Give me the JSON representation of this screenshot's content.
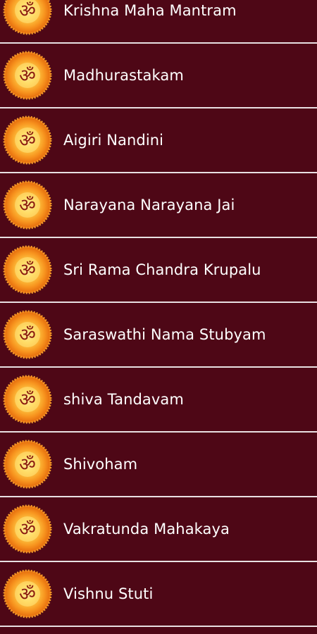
{
  "list": {
    "items": [
      {
        "label": "Krishna Maha Mantram",
        "icon": "om-icon"
      },
      {
        "label": "Madhurastakam",
        "icon": "om-icon"
      },
      {
        "label": "Aigiri Nandini",
        "icon": "om-icon"
      },
      {
        "label": "Narayana Narayana Jai",
        "icon": "om-icon"
      },
      {
        "label": "Sri Rama Chandra Krupalu",
        "icon": "om-icon"
      },
      {
        "label": "Saraswathi Nama Stubyam",
        "icon": "om-icon"
      },
      {
        "label": "shiva Tandavam",
        "icon": "om-icon"
      },
      {
        "label": "Shivoham",
        "icon": "om-icon"
      },
      {
        "label": "Vakratunda Mahakaya",
        "icon": "om-icon"
      },
      {
        "label": "Vishnu Stuti",
        "icon": "om-icon"
      }
    ]
  },
  "colors": {
    "background": "#4e0716",
    "divider": "#e8e0e2",
    "text": "#ffffff",
    "icon_orange": "#f7931e"
  },
  "icon_glyph": "ॐ"
}
